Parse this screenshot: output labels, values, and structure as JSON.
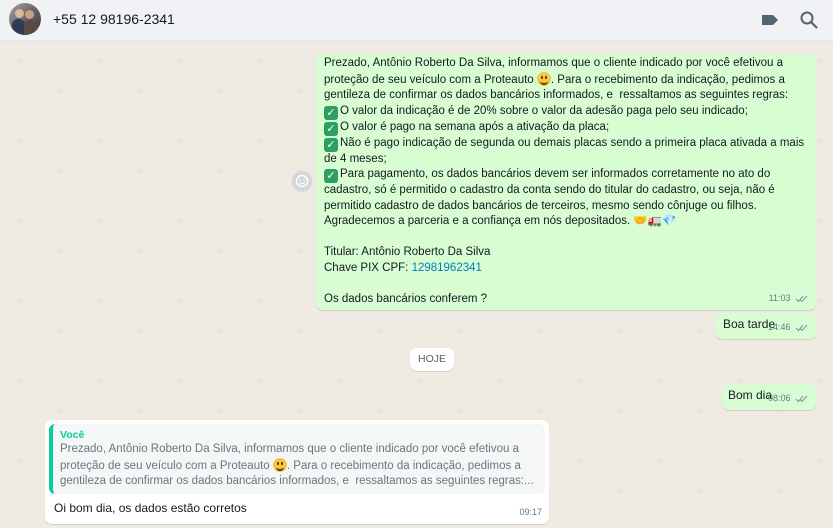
{
  "header": {
    "contact": "+55 12 98196-2341",
    "avatar_icon": "avatar-photo",
    "actions": [
      "label-icon",
      "search-icon"
    ]
  },
  "messages": [
    {
      "direction": "out",
      "intro": "Prezado, Antônio Roberto Da Silva, informamos que o cliente indicado por você efetivou a proteção de seu veículo com a Proteauto ",
      "intro2": ". Para o recebimento da indicação, pedimos a gentileza de confirmar os dados bancários informados, e  ressaltamos as seguintes regras:",
      "rules": [
        "O valor da indicação é de 20% sobre o valor da adesão paga pelo seu indicado;",
        "O valor é pago na semana após a ativação da placa;",
        "Não é pago indicação de segunda ou demais placas sendo a primeira placa ativada a mais de 4 meses;",
        "Para pagamento, os dados bancários devem ser informados corretamente no ato do cadastro, só é permitido o cadastro da conta sendo do titular do cadastro, ou seja, não é permitido cadastro de dados bancários de terceiros, mesmo sendo cônjuge ou filhos."
      ],
      "thanks": "Agradecemos a parceria e a confiança em nós depositados. ",
      "titular": "Titular: Antônio Roberto Da Silva",
      "pix_label": "Chave PIX CPF: ",
      "pix_value": "12981962341",
      "question": "Os dados bancários conferem ?",
      "time": "11:03"
    },
    {
      "direction": "out",
      "text": "Boa tarde",
      "time": "14:46"
    },
    {
      "direction": "out",
      "text": "Bom dia",
      "time": "08:06"
    },
    {
      "direction": "in",
      "quote_author": "Você",
      "quote_text_1": "Prezado, Antônio Roberto Da Silva, informamos que o cliente indicado por você efetivou a proteção de seu veículo com a Proteauto ",
      "quote_text_2": ". Para o recebimento da indicação, pedimos a gentileza de confirmar os dados bancários informados, e  ressaltamos as seguintes regras:...",
      "text": "Oi bom dia, os dados estão corretos",
      "time": "09:17"
    }
  ],
  "day_separator": "HOJE",
  "colors": {
    "outgoing_bubble": "#d9fdd3",
    "incoming_bubble": "#ffffff",
    "quote_accent": "#06cf9c",
    "link": "#027eb5"
  }
}
